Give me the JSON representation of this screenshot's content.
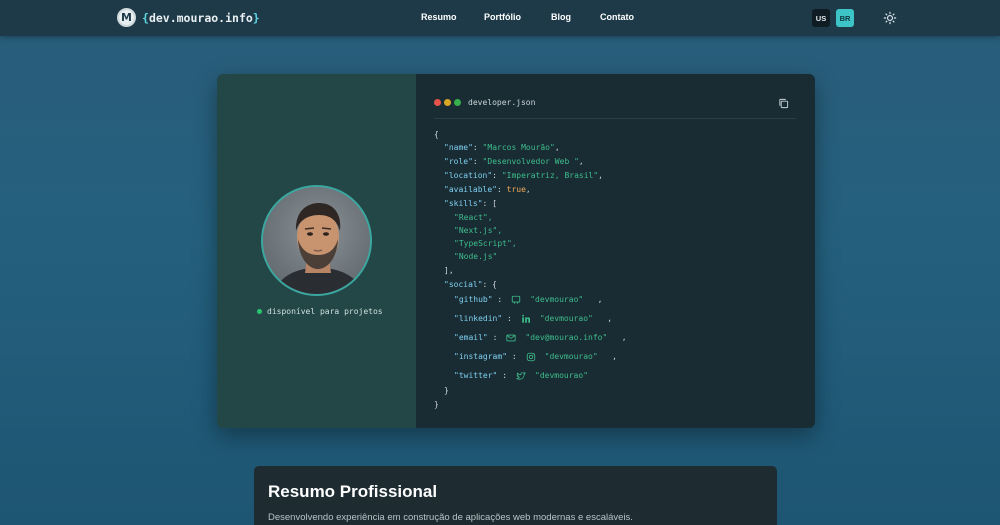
{
  "brand": {
    "logo_letter": "M",
    "open_brace": "{",
    "name": "dev.mourao.info",
    "close_brace": "}"
  },
  "nav": {
    "links": [
      "Resumo",
      "Portfólio",
      "Blog",
      "Contato"
    ],
    "languages": [
      "US",
      "BR"
    ],
    "active_language": "BR",
    "theme_icon": "sun-icon"
  },
  "profile": {
    "availability": "disponível para projetos"
  },
  "code_window": {
    "filename": "developer.json",
    "copy_icon": "copy-icon"
  },
  "developer": {
    "name": "Marcos Mourão",
    "role": "Desenvolvedor Web ",
    "location": "Imperatriz, Brasil",
    "available": "true",
    "skills": [
      "React",
      "Next.js",
      "TypeScript",
      "Node.js"
    ],
    "social": [
      {
        "key": "github",
        "icon": "github-icon",
        "handle": "devmourao"
      },
      {
        "key": "linkedin",
        "icon": "linkedin-icon",
        "handle": "devmourao"
      },
      {
        "key": "email",
        "icon": "mail-icon",
        "handle": "dev@mourao.info"
      },
      {
        "key": "instagram",
        "icon": "instagram-icon",
        "handle": "devmourao"
      },
      {
        "key": "twitter",
        "icon": "twitter-icon",
        "handle": "devmourao"
      }
    ]
  },
  "resumo": {
    "title": "Resumo Profissional",
    "text": "Desenvolvendo experiência em construção de aplicações web modernas e escaláveis."
  },
  "colors": {
    "accent": "#3dc4c7",
    "json_key": "#7fd0f2",
    "json_string": "#3dbd8c",
    "json_boolean": "#f0a95a",
    "available_dot": "#28c76f"
  }
}
